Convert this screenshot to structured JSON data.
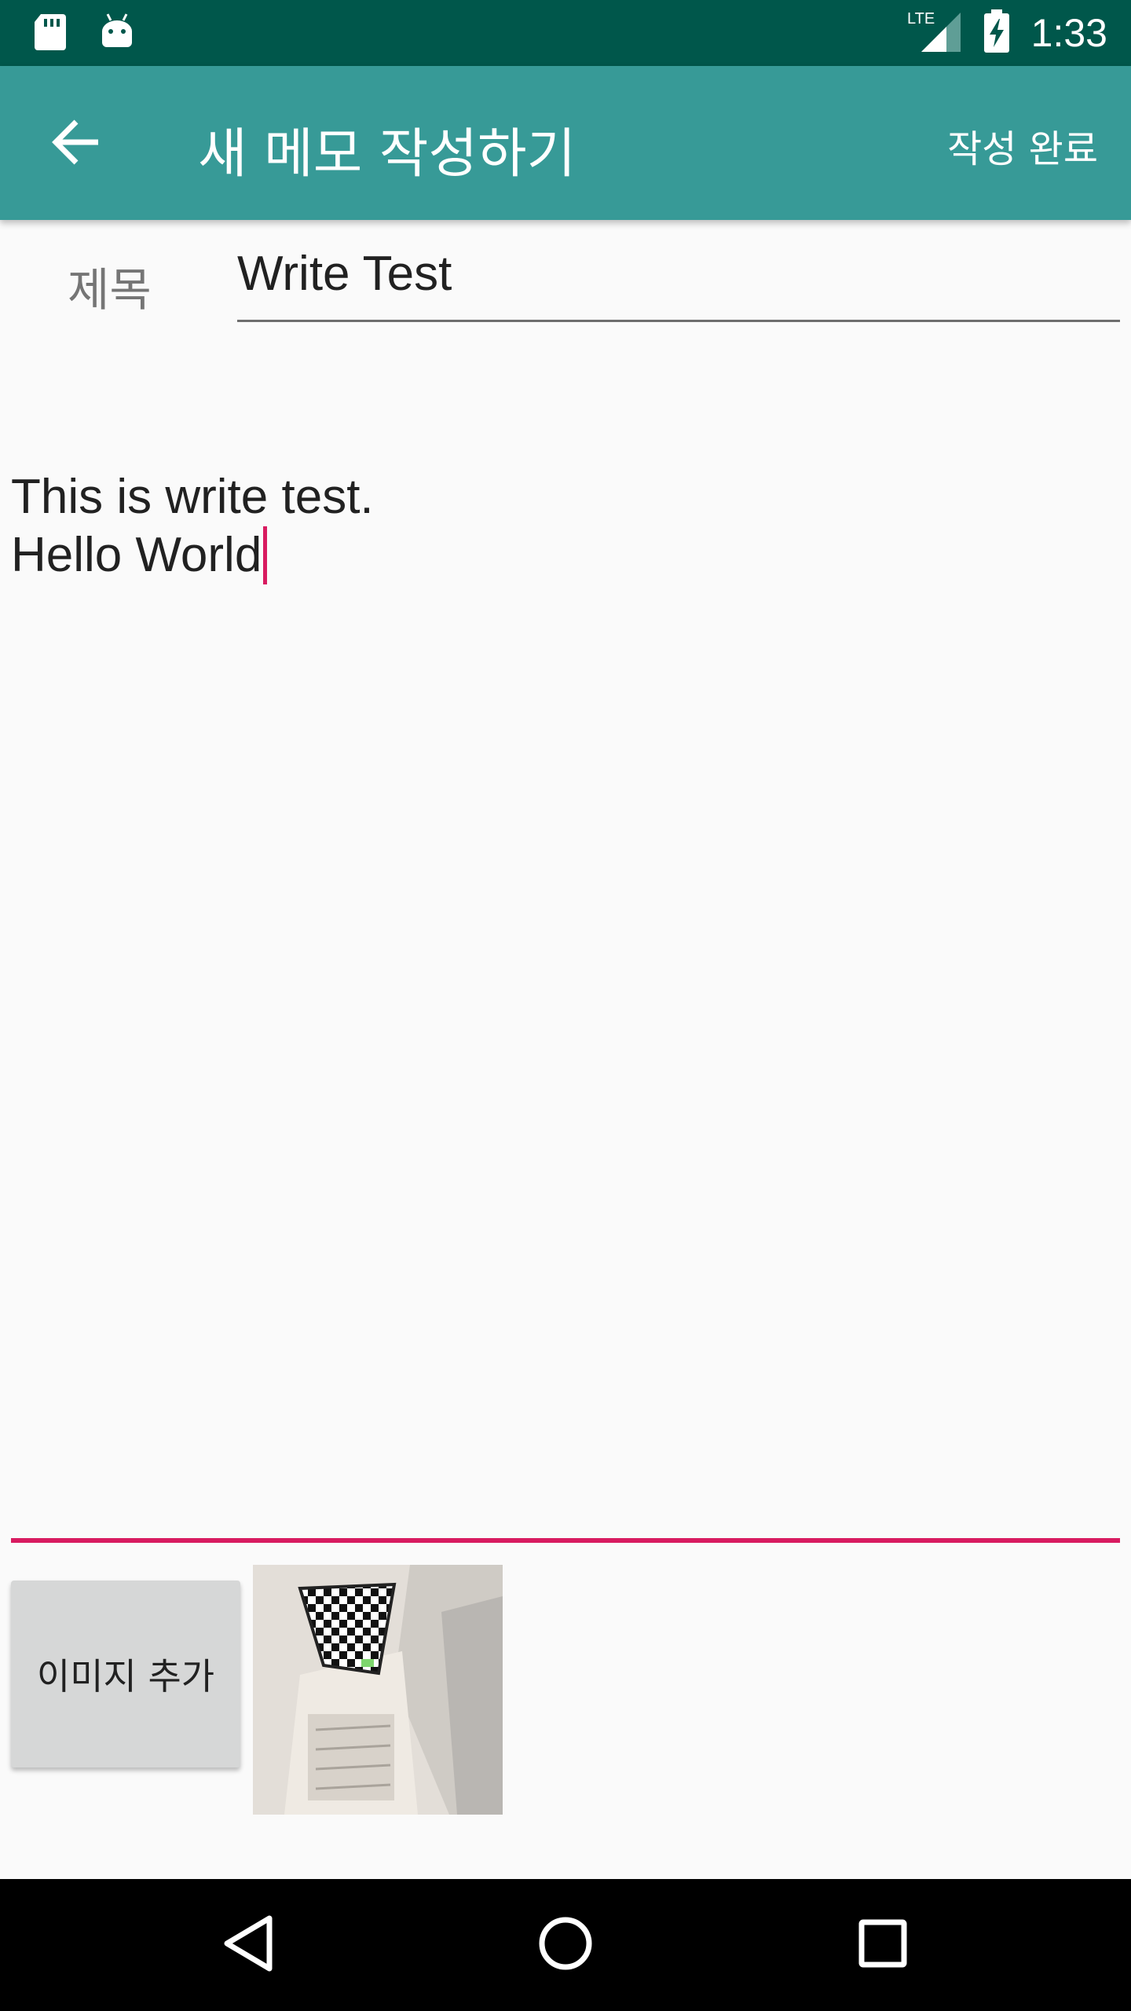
{
  "status_bar": {
    "time": "1:33",
    "network": "LTE",
    "icons": [
      "sd-card-icon",
      "android-icon",
      "lte-signal-icon",
      "battery-charging-icon"
    ]
  },
  "app_bar": {
    "title": "새 메모 작성하기",
    "done_label": "작성 완료",
    "back_icon": "arrow-back-icon"
  },
  "form": {
    "title_label": "제목",
    "title_value": "Write Test",
    "body_value": "This is write test.\nHello World"
  },
  "image_section": {
    "add_button_label": "이미지 추가"
  },
  "nav_bar": {
    "icons": [
      "nav-back-icon",
      "nav-home-icon",
      "nav-recents-icon"
    ]
  },
  "colors": {
    "status_bar": "#00574b",
    "app_bar": "#379a97",
    "accent": "#d81b60",
    "background": "#fafafa"
  }
}
